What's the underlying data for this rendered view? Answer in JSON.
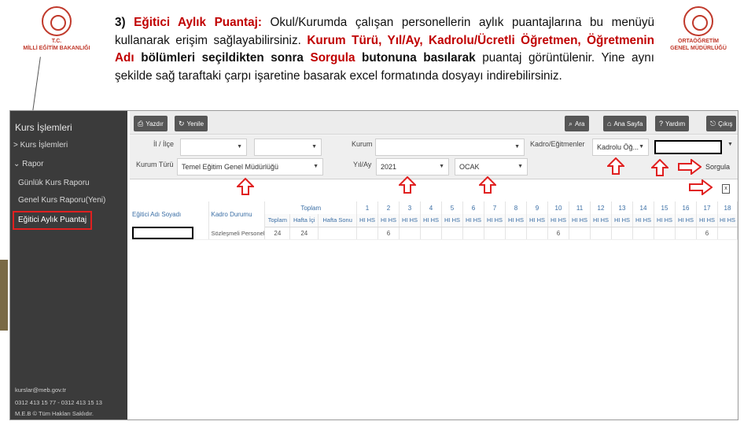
{
  "logos": {
    "left": {
      "line1": "T.C.",
      "line2": "MİLLİ EĞİTİM BAKANLIĞI"
    },
    "right": {
      "line1": "ORTAÖĞRETİM",
      "line2": "GENEL MÜDÜRLÜĞÜ"
    }
  },
  "intro": {
    "number": "3)",
    "title": "Eğitici Aylık Puantaj:",
    "p1": " Okul/Kurumda çalışan personellerin aylık puantajlarına bu menüyü kullanarak erişim sağlayabilirsiniz. ",
    "fields": "Kurum Türü, Yıl/Ay, Kadrolu/Ücretli Öğretmen, Öğretmenin Adı",
    "p2": " bölümleri seçildikten sonra ",
    "sorgula": "Sorgula",
    "p3": " butonuna ",
    "basilarak": "basılarak",
    "p4": " puantaj görüntülenir. Yine aynı şekilde sağ taraftaki çarpı işaretine basarak excel formatında dosyayı indirebilirsiniz."
  },
  "sidebar": {
    "title": "Kurs İşlemleri",
    "items": [
      "> Kurs İşlemleri",
      "⌄ Rapor",
      "Günlük Kurs Raporu",
      "Genel Kurs Raporu(Yeni)",
      "Eğitici Aylık Puantaj"
    ],
    "footer": [
      "kurslar@meb.gov.tr",
      "0312 413 15 77 - 0312 413 15 13",
      "M.E.B ©    Tüm Hakları Saklıdır."
    ]
  },
  "toolbar": {
    "print": "Yazdır",
    "refresh": "Yenile",
    "search": "Ara",
    "home": "Ana Sayfa",
    "help": "Yardım",
    "exit": "Çıkış"
  },
  "filters": {
    "il_ilce_label": "İl / İlçe",
    "kurum_label": "Kurum",
    "kadro_label": "Kadro/Eğitmenler",
    "kadro_value": "Kadrolu Öğ...",
    "kurum_turu_label": "Kurum Türü",
    "kurum_turu_value": "Temel Eğitim Genel Müdürlüğü",
    "yil_ay_label": "Yıl/Ay",
    "year": "2021",
    "month": "OCAK",
    "sorgula": "Sorgula"
  },
  "grid": {
    "col_name": "Eğitici Adı Soyadı",
    "col_kadro": "Kadro Durumu",
    "col_toplam": "Toplam",
    "days": [
      "1",
      "2",
      "3",
      "4",
      "5",
      "6",
      "7",
      "8",
      "9",
      "10",
      "11",
      "12",
      "13",
      "14",
      "15",
      "16",
      "17",
      "18"
    ],
    "sub_toplam": "Toplam",
    "sub_hafta_ici": "Hafta İçi",
    "sub_hafta_sonu": "Hafta Sonu",
    "sub_hi": "HI",
    "sub_hs": "HS",
    "row": {
      "kadro": "Sözleşmeli Personel",
      "toplam": "24",
      "hafta_ici": "24",
      "d2": "6",
      "d10": "6",
      "d17": "6"
    }
  }
}
